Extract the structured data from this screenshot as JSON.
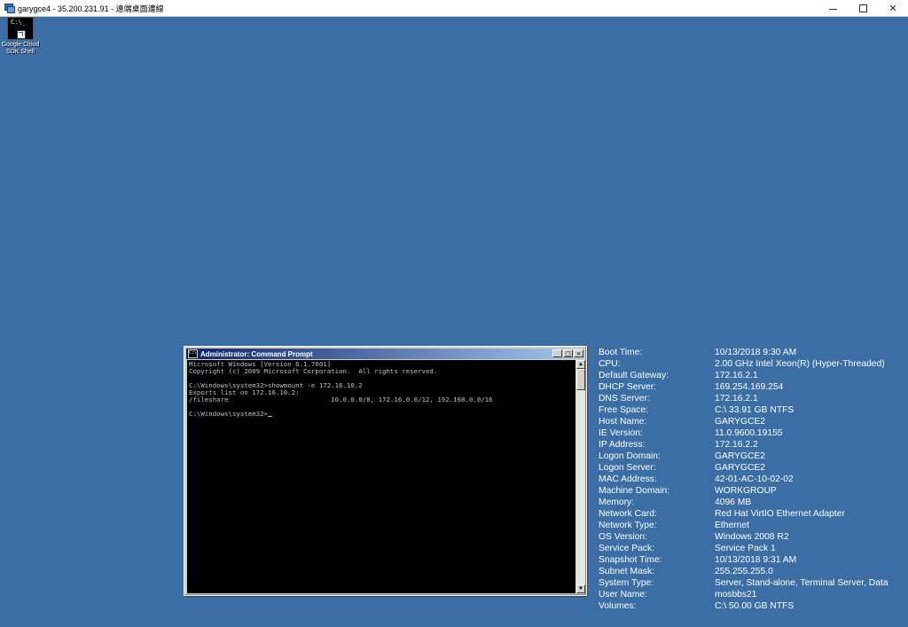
{
  "rdp_window": {
    "title": "garygce4 - 35.200.231.91 - 遠端桌面連線"
  },
  "desktop": {
    "icons": [
      {
        "label_line1": "Google Cloud",
        "label_line2": "SDK Shell",
        "glyph": "C:\\_"
      }
    ]
  },
  "cmd_window": {
    "title": "Administrator: Command Prompt",
    "icon_glyph": "C:\\",
    "buttons": {
      "minimize": "_",
      "maximize": "□",
      "close": "×"
    },
    "lines": [
      "Microsoft Windows [Version 6.1.7601]",
      "Copyright (c) 2009 Microsoft Corporation.  All rights reserved.",
      "",
      "C:\\Windows\\system32>showmount -e 172.16.10.2",
      "Exports list on 172.16.10.2:",
      "/fileshare                          10.0.0.0/8, 172.16.0.0/12, 192.168.0.0/16",
      "",
      "C:\\Windows\\system32>"
    ],
    "scroll_up": "▲",
    "scroll_down": "▼"
  },
  "bginfo": [
    {
      "label": "Boot Time:",
      "value": "10/13/2018 9:30 AM"
    },
    {
      "label": "CPU:",
      "value": "2.00 GHz Intel Xeon(R) (Hyper-Threaded)"
    },
    {
      "label": "Default Gateway:",
      "value": "172.16.2.1"
    },
    {
      "label": "DHCP Server:",
      "value": "169.254.169.254"
    },
    {
      "label": "DNS Server:",
      "value": "172.16.2.1"
    },
    {
      "label": "Free Space:",
      "value": "C:\\ 33.91 GB NTFS"
    },
    {
      "label": "Host Name:",
      "value": "GARYGCE2"
    },
    {
      "label": "IE Version:",
      "value": "11.0.9600.19155"
    },
    {
      "label": "IP Address:",
      "value": "172.16.2.2"
    },
    {
      "label": "Logon Domain:",
      "value": "GARYGCE2"
    },
    {
      "label": "Logon Server:",
      "value": "GARYGCE2"
    },
    {
      "label": "MAC Address:",
      "value": "42-01-AC-10-02-02"
    },
    {
      "label": "Machine Domain:",
      "value": "WORKGROUP"
    },
    {
      "label": "Memory:",
      "value": "4096 MB"
    },
    {
      "label": "Network Card:",
      "value": "Red Hat VirtIO Ethernet Adapter"
    },
    {
      "label": "Network Type:",
      "value": "Ethernet"
    },
    {
      "label": "OS Version:",
      "value": "Windows 2008 R2"
    },
    {
      "label": "Service Pack:",
      "value": "Service Pack 1"
    },
    {
      "label": "Snapshot Time:",
      "value": "10/13/2018 9:31 AM"
    },
    {
      "label": "Subnet Mask:",
      "value": "255.255.255.0"
    },
    {
      "label": "System Type:",
      "value": "Server, Stand-alone, Terminal Server, Data"
    },
    {
      "label": "User Name:",
      "value": "mosbbs21"
    },
    {
      "label": "Volumes:",
      "value": "C:\\ 50.00 GB NTFS"
    }
  ]
}
